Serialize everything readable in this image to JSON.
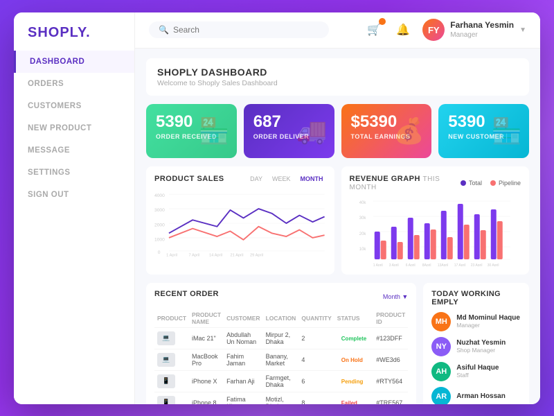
{
  "logo": {
    "text": "SHOPLY.",
    "dot": "."
  },
  "nav": {
    "items": [
      {
        "id": "dashboard",
        "label": "DASHBOARD",
        "active": true
      },
      {
        "id": "orders",
        "label": "ORDERS",
        "active": false
      },
      {
        "id": "customers",
        "label": "CUSTOMERS",
        "active": false
      },
      {
        "id": "new-product",
        "label": "NEW PRODUCT",
        "active": false
      },
      {
        "id": "message",
        "label": "MESSAGE",
        "active": false
      },
      {
        "id": "settings",
        "label": "SETTINGS",
        "active": false
      },
      {
        "id": "sign-out",
        "label": "SIGN OUT",
        "active": false
      }
    ]
  },
  "topbar": {
    "search_placeholder": "Search",
    "user": {
      "name": "Farhana Yesmin",
      "role": "Manager",
      "initials": "FY"
    }
  },
  "dashboard": {
    "title": "SHOPLY DASHBOARD",
    "subtitle": "Welcome to Shoply Sales Dashboard"
  },
  "stats": [
    {
      "id": "order-received",
      "number": "5390",
      "label": "ORDER RECEIVED",
      "icon": "🏪",
      "color": "green"
    },
    {
      "id": "order-deliver",
      "number": "687",
      "label": "ORDER DELIVER",
      "icon": "🚚",
      "color": "purple"
    },
    {
      "id": "total-earnings",
      "number": "$5390",
      "label": "TOTAL EARNINGS",
      "icon": "💰",
      "color": "pink"
    },
    {
      "id": "new-customer",
      "number": "5390",
      "label": "NEW CUSTOMER",
      "icon": "🏪",
      "color": "cyan"
    }
  ],
  "product_sales": {
    "title": "PRODUCT SALES",
    "tabs": [
      "DAY",
      "WEEK",
      "MONTH"
    ],
    "active_tab": "MONTH",
    "x_labels": [
      "1 April",
      "7 April",
      "14 April",
      "21 April",
      "29 April"
    ],
    "y_labels": [
      "4000",
      "3000",
      "2000",
      "1000",
      "0"
    ]
  },
  "revenue_graph": {
    "title": "REVENUE GRAPH",
    "subtitle": "THIS MONTH",
    "legend": [
      {
        "label": "Total",
        "color": "#5a2fc2"
      },
      {
        "label": "Pipeline",
        "color": "#f87171"
      }
    ],
    "x_labels": [
      "1 April",
      "3 April",
      "6 April",
      "8April",
      "13April",
      "17 April",
      "23 April",
      "30 April"
    ],
    "bars": [
      {
        "purple": 45,
        "pink": 30
      },
      {
        "purple": 55,
        "pink": 25
      },
      {
        "purple": 70,
        "pink": 40
      },
      {
        "purple": 60,
        "pink": 50
      },
      {
        "purple": 80,
        "pink": 35
      },
      {
        "purple": 90,
        "pink": 55
      },
      {
        "purple": 65,
        "pink": 45
      },
      {
        "purple": 75,
        "pink": 60
      }
    ],
    "y_labels": [
      "40k",
      "30k",
      "20k",
      "10k"
    ]
  },
  "recent_orders": {
    "title": "RECENT ORDER",
    "filter": "Month",
    "columns": [
      "Product",
      "Product Name",
      "Customer",
      "Location",
      "Quantity",
      "Status",
      "Product ID"
    ],
    "rows": [
      {
        "thumb": "💻",
        "product_name": "iMac 21\"",
        "customer": "Abdullah Un Noman",
        "location": "Mirpur 2, Dhaka",
        "qty": "2",
        "status": "Complete",
        "status_class": "status-complete",
        "product_id": "#123DFF",
        "bg": "#dbeafe"
      },
      {
        "thumb": "💻",
        "product_name": "MacBook Pro",
        "customer": "Fahim Jaman",
        "location": "Banany, Market",
        "qty": "4",
        "status": "On Hold",
        "status_class": "status-hold",
        "product_id": "#WE3d6",
        "bg": "#e5e7eb"
      },
      {
        "thumb": "📱",
        "product_name": "iPhone X",
        "customer": "Farhan Aji",
        "location": "Farmget, Dhaka",
        "qty": "6",
        "status": "Pending",
        "status_class": "status-pending",
        "product_id": "#RTY564",
        "bg": "#f3f4f6"
      },
      {
        "thumb": "📱",
        "product_name": "iPhone 8",
        "customer": "Fatima Khatun",
        "location": "Motizl, Dhaka",
        "qty": "8",
        "status": "Failed",
        "status_class": "status-failed",
        "product_id": "#TRE567",
        "bg": "#fee2e2"
      }
    ]
  },
  "today_employees": {
    "title": "TODAY WORKING EMPLY",
    "employees": [
      {
        "name": "Md Mominul Haque",
        "role": "Manager",
        "initials": "MH",
        "color": "#f97316"
      },
      {
        "name": "Nuzhat Yesmin",
        "role": "Shop Manager",
        "initials": "NY",
        "color": "#8b5cf6"
      },
      {
        "name": "Asiful Haque",
        "role": "Staff",
        "initials": "AH",
        "color": "#10b981"
      },
      {
        "name": "Arman Hossan",
        "role": "",
        "initials": "AR",
        "color": "#06b6d4"
      }
    ]
  }
}
